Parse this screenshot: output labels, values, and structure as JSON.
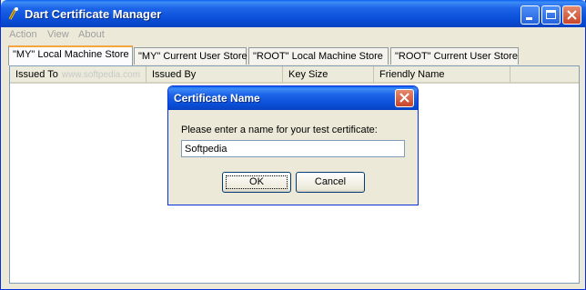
{
  "window": {
    "title": "Dart Certificate Manager"
  },
  "menu": {
    "items": [
      "Action",
      "View",
      "About"
    ]
  },
  "tabs": [
    {
      "label": "\"MY\" Local Machine Store",
      "active": true
    },
    {
      "label": "\"MY\" Current User Store",
      "active": false
    },
    {
      "label": "\"ROOT\" Local Machine Store",
      "active": false
    },
    {
      "label": "\"ROOT\" Current User Store",
      "active": false
    }
  ],
  "table": {
    "columns": [
      "Issued To",
      "Issued By",
      "Key Size",
      "Friendly Name"
    ],
    "watermark": "www.softpedia.com"
  },
  "dialog": {
    "title": "Certificate Name",
    "prompt": "Please enter a name for your test certificate:",
    "input_value": "Softpedia",
    "ok_label": "OK",
    "cancel_label": "Cancel"
  }
}
